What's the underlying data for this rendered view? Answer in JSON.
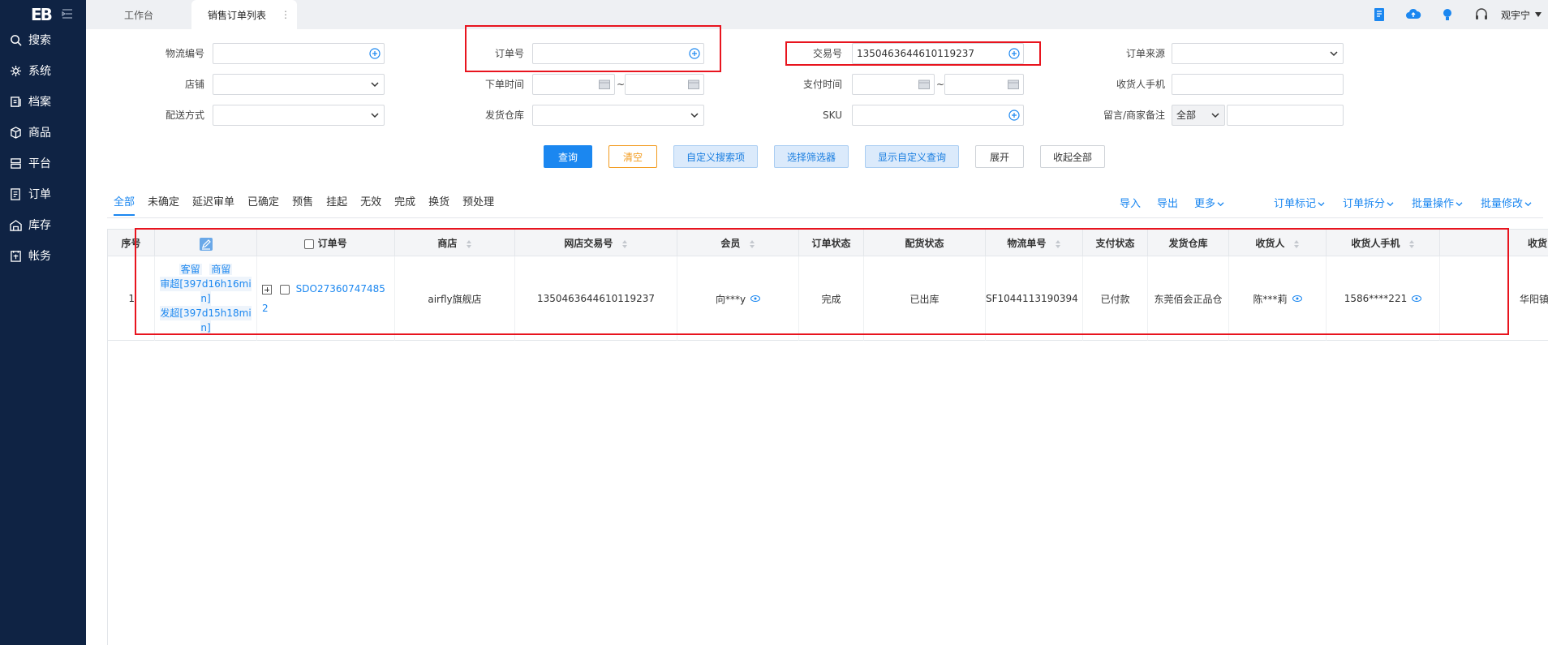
{
  "app": {
    "logo": "EB"
  },
  "sidebar": {
    "items": [
      {
        "label": "搜索",
        "icon": "search-icon"
      },
      {
        "label": "系统",
        "icon": "gear-icon"
      },
      {
        "label": "档案",
        "icon": "archive-icon"
      },
      {
        "label": "商品",
        "icon": "box-icon"
      },
      {
        "label": "平台",
        "icon": "platform-icon"
      },
      {
        "label": "订单",
        "icon": "order-icon"
      },
      {
        "label": "库存",
        "icon": "warehouse-icon"
      },
      {
        "label": "帐务",
        "icon": "account-icon"
      }
    ]
  },
  "topbar": {
    "tabs": [
      {
        "label": "工作台"
      },
      {
        "label": "销售订单列表",
        "more": "⋮"
      }
    ],
    "user": "观宇宁"
  },
  "form": {
    "logistics_no": "物流编号",
    "order_no": "订单号",
    "trade_no": "交易号",
    "trade_no_value": "1350463644610119237",
    "order_source": "订单来源",
    "shop": "店铺",
    "order_time": "下单时间",
    "pay_time": "支付时间",
    "receiver_phone": "收货人手机",
    "delivery_method": "配送方式",
    "warehouse": "发货仓库",
    "sku": "SKU",
    "remark": "留言/商家备注",
    "remark_select": "全部",
    "tilde": "~"
  },
  "buttons": {
    "query": "查询",
    "clear": "清空",
    "custom_search": "自定义搜索项",
    "select_filter": "选择筛选器",
    "show_custom_query": "显示自定义查询",
    "expand": "展开",
    "collapse_all": "收起全部"
  },
  "status_tabs": [
    "全部",
    "未确定",
    "延迟审单",
    "已确定",
    "预售",
    "挂起",
    "无效",
    "完成",
    "换货",
    "预处理"
  ],
  "actions": {
    "import": "导入",
    "export": "导出",
    "more": "更多",
    "order_mark": "订单标记",
    "order_split": "订单拆分",
    "batch_op": "批量操作",
    "batch_edit": "批量修改"
  },
  "table": {
    "headers": {
      "seq": "序号",
      "order_no": "订单号",
      "shop": "商店",
      "trade_no": "网店交易号",
      "member": "会员",
      "order_status": "订单状态",
      "dist_status": "配货状态",
      "logistics_no": "物流单号",
      "pay_status": "支付状态",
      "warehouse": "发货仓库",
      "receiver": "收货人",
      "receiver_phone": "收货人手机",
      "last": "收货"
    },
    "row": {
      "seq": "1",
      "tag1": "客留",
      "tag2": "商留",
      "audit_over_1": "审超[397d16h16mi",
      "audit_over_2": "n]",
      "ship_over_1": "发超[397d15h18mi",
      "ship_over_2": "n]",
      "order_no_1": "SDO27360747485",
      "order_no_2": "2",
      "shop": "airfly旗舰店",
      "trade_no": "1350463644610119237",
      "member": "向***y",
      "order_status": "完成",
      "dist_status": "已出库",
      "logistics_no": "SF1044113190394",
      "pay_status": "已付款",
      "warehouse": "东莞佰会正品仓",
      "receiver": "陈***莉",
      "receiver_phone": "1586****221",
      "last": "华阳镇"
    }
  },
  "colors": {
    "accent": "#1b87f0",
    "sidebar": "#0f2344",
    "highlight": "#e8141e",
    "warn": "#f29a1c"
  }
}
